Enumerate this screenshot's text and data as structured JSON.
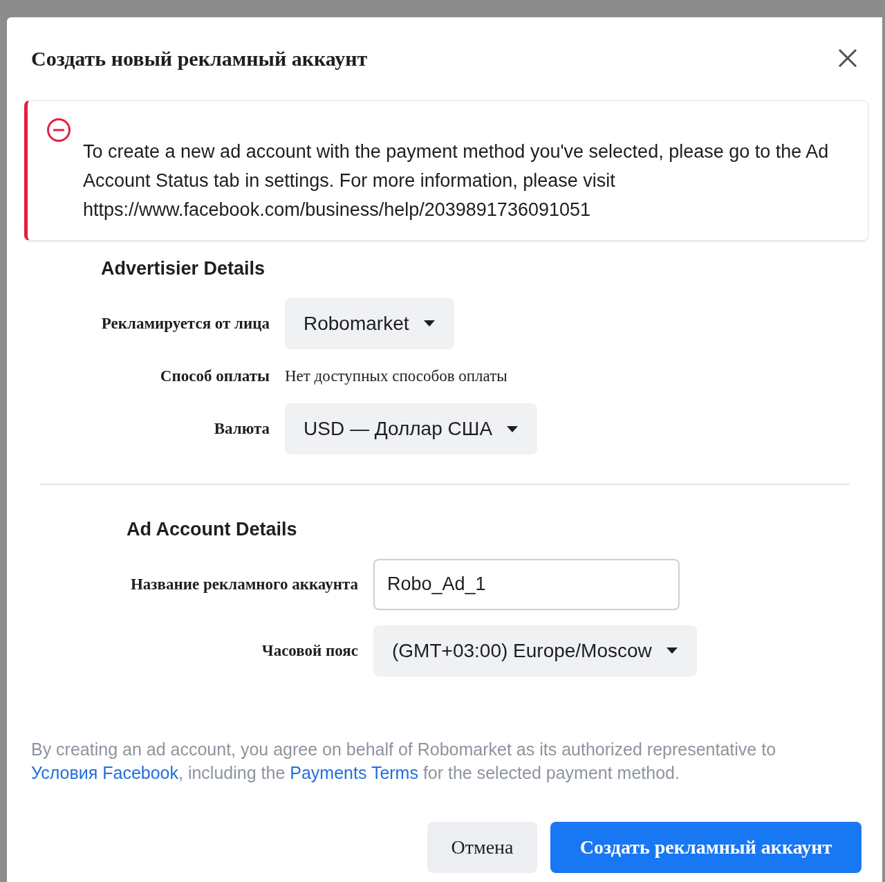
{
  "dialog": {
    "title": "Создать новый рекламный аккаунт"
  },
  "alert": {
    "text": "To create a new ad account with the payment method you've selected, please go to the Ad Account Status tab in settings. For more information, please visit https://www.facebook.com/business/help/2039891736091051"
  },
  "advertiser_details": {
    "heading": "Advertisier Details",
    "rows": [
      {
        "kind": "dropdown",
        "label": "Рекламируется от лица",
        "value": "Robomarket"
      },
      {
        "kind": "text",
        "label": "Способ оплаты",
        "value": "Нет доступных способов оплаты"
      },
      {
        "kind": "dropdown",
        "label": "Валюта",
        "value": "USD — Доллар США"
      }
    ]
  },
  "ad_account_details": {
    "heading": "Ad Account Details",
    "rows": [
      {
        "kind": "input",
        "label": "Название рекламного аккаунта",
        "value": "Robo_Ad_1"
      },
      {
        "kind": "dropdown",
        "label": "Часовой пояс",
        "value": "(GMT+03:00) Europe/Moscow"
      }
    ]
  },
  "terms": [
    {
      "kind": "text",
      "text": "By creating an ad account, you agree on behalf of Robomarket as its authorized representative to "
    },
    {
      "kind": "link",
      "text": "Условия Facebook"
    },
    {
      "kind": "text",
      "text": ", including the "
    },
    {
      "kind": "link",
      "text": "Payments Terms"
    },
    {
      "kind": "text",
      "text": " for the selected payment method."
    }
  ],
  "buttons": [
    {
      "kind": "secondary",
      "label": "Отмена"
    },
    {
      "kind": "primary",
      "label": "Создать рекламный аккаунт"
    }
  ]
}
